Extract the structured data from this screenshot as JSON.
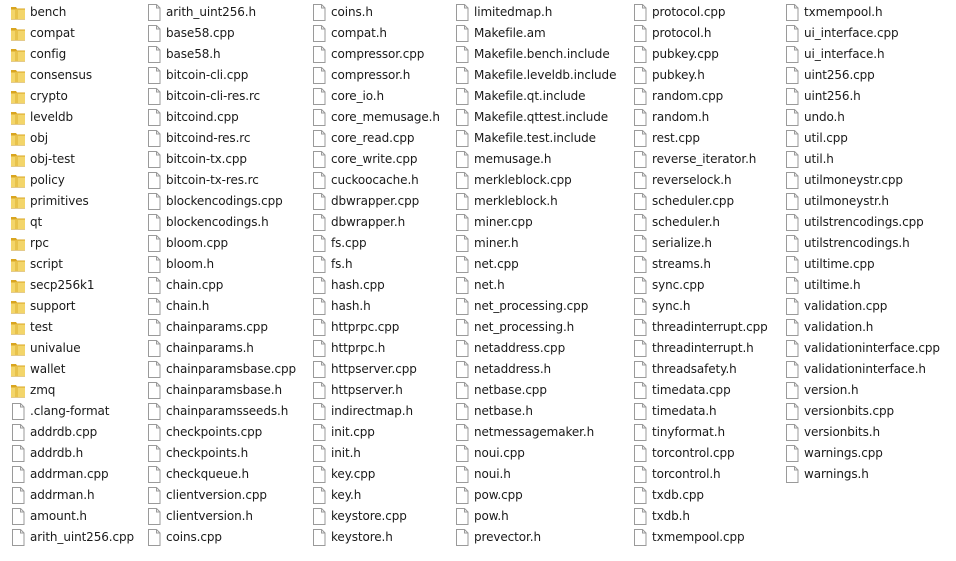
{
  "view": {
    "columns": [
      {
        "items": [
          {
            "name": "bench",
            "type": "folder"
          },
          {
            "name": "compat",
            "type": "folder"
          },
          {
            "name": "config",
            "type": "folder"
          },
          {
            "name": "consensus",
            "type": "folder"
          },
          {
            "name": "crypto",
            "type": "folder"
          },
          {
            "name": "leveldb",
            "type": "folder"
          },
          {
            "name": "obj",
            "type": "folder"
          },
          {
            "name": "obj-test",
            "type": "folder"
          },
          {
            "name": "policy",
            "type": "folder"
          },
          {
            "name": "primitives",
            "type": "folder"
          },
          {
            "name": "qt",
            "type": "folder"
          },
          {
            "name": "rpc",
            "type": "folder"
          },
          {
            "name": "script",
            "type": "folder"
          },
          {
            "name": "secp256k1",
            "type": "folder"
          },
          {
            "name": "support",
            "type": "folder"
          },
          {
            "name": "test",
            "type": "folder"
          },
          {
            "name": "univalue",
            "type": "folder"
          },
          {
            "name": "wallet",
            "type": "folder"
          },
          {
            "name": "zmq",
            "type": "folder"
          },
          {
            "name": ".clang-format",
            "type": "file"
          },
          {
            "name": "addrdb.cpp",
            "type": "file"
          },
          {
            "name": "addrdb.h",
            "type": "file"
          },
          {
            "name": "addrman.cpp",
            "type": "file"
          },
          {
            "name": "addrman.h",
            "type": "file"
          },
          {
            "name": "amount.h",
            "type": "file"
          },
          {
            "name": "arith_uint256.cpp",
            "type": "file"
          }
        ]
      },
      {
        "items": [
          {
            "name": "arith_uint256.h",
            "type": "file"
          },
          {
            "name": "base58.cpp",
            "type": "file"
          },
          {
            "name": "base58.h",
            "type": "file"
          },
          {
            "name": "bitcoin-cli.cpp",
            "type": "file"
          },
          {
            "name": "bitcoin-cli-res.rc",
            "type": "file"
          },
          {
            "name": "bitcoind.cpp",
            "type": "file"
          },
          {
            "name": "bitcoind-res.rc",
            "type": "file"
          },
          {
            "name": "bitcoin-tx.cpp",
            "type": "file"
          },
          {
            "name": "bitcoin-tx-res.rc",
            "type": "file"
          },
          {
            "name": "blockencodings.cpp",
            "type": "file"
          },
          {
            "name": "blockencodings.h",
            "type": "file"
          },
          {
            "name": "bloom.cpp",
            "type": "file"
          },
          {
            "name": "bloom.h",
            "type": "file"
          },
          {
            "name": "chain.cpp",
            "type": "file"
          },
          {
            "name": "chain.h",
            "type": "file"
          },
          {
            "name": "chainparams.cpp",
            "type": "file"
          },
          {
            "name": "chainparams.h",
            "type": "file"
          },
          {
            "name": "chainparamsbase.cpp",
            "type": "file"
          },
          {
            "name": "chainparamsbase.h",
            "type": "file"
          },
          {
            "name": "chainparamsseeds.h",
            "type": "file"
          },
          {
            "name": "checkpoints.cpp",
            "type": "file"
          },
          {
            "name": "checkpoints.h",
            "type": "file"
          },
          {
            "name": "checkqueue.h",
            "type": "file"
          },
          {
            "name": "clientversion.cpp",
            "type": "file"
          },
          {
            "name": "clientversion.h",
            "type": "file"
          },
          {
            "name": "coins.cpp",
            "type": "file"
          }
        ]
      },
      {
        "items": [
          {
            "name": "coins.h",
            "type": "file"
          },
          {
            "name": "compat.h",
            "type": "file"
          },
          {
            "name": "compressor.cpp",
            "type": "file"
          },
          {
            "name": "compressor.h",
            "type": "file"
          },
          {
            "name": "core_io.h",
            "type": "file"
          },
          {
            "name": "core_memusage.h",
            "type": "file"
          },
          {
            "name": "core_read.cpp",
            "type": "file"
          },
          {
            "name": "core_write.cpp",
            "type": "file"
          },
          {
            "name": "cuckoocache.h",
            "type": "file"
          },
          {
            "name": "dbwrapper.cpp",
            "type": "file"
          },
          {
            "name": "dbwrapper.h",
            "type": "file"
          },
          {
            "name": "fs.cpp",
            "type": "file"
          },
          {
            "name": "fs.h",
            "type": "file"
          },
          {
            "name": "hash.cpp",
            "type": "file"
          },
          {
            "name": "hash.h",
            "type": "file"
          },
          {
            "name": "httprpc.cpp",
            "type": "file"
          },
          {
            "name": "httprpc.h",
            "type": "file"
          },
          {
            "name": "httpserver.cpp",
            "type": "file"
          },
          {
            "name": "httpserver.h",
            "type": "file"
          },
          {
            "name": "indirectmap.h",
            "type": "file"
          },
          {
            "name": "init.cpp",
            "type": "file"
          },
          {
            "name": "init.h",
            "type": "file"
          },
          {
            "name": "key.cpp",
            "type": "file"
          },
          {
            "name": "key.h",
            "type": "file"
          },
          {
            "name": "keystore.cpp",
            "type": "file"
          },
          {
            "name": "keystore.h",
            "type": "file"
          }
        ]
      },
      {
        "items": [
          {
            "name": "limitedmap.h",
            "type": "file"
          },
          {
            "name": "Makefile.am",
            "type": "file"
          },
          {
            "name": "Makefile.bench.include",
            "type": "file"
          },
          {
            "name": "Makefile.leveldb.include",
            "type": "file"
          },
          {
            "name": "Makefile.qt.include",
            "type": "file"
          },
          {
            "name": "Makefile.qttest.include",
            "type": "file"
          },
          {
            "name": "Makefile.test.include",
            "type": "file"
          },
          {
            "name": "memusage.h",
            "type": "file"
          },
          {
            "name": "merkleblock.cpp",
            "type": "file"
          },
          {
            "name": "merkleblock.h",
            "type": "file"
          },
          {
            "name": "miner.cpp",
            "type": "file"
          },
          {
            "name": "miner.h",
            "type": "file"
          },
          {
            "name": "net.cpp",
            "type": "file"
          },
          {
            "name": "net.h",
            "type": "file"
          },
          {
            "name": "net_processing.cpp",
            "type": "file"
          },
          {
            "name": "net_processing.h",
            "type": "file"
          },
          {
            "name": "netaddress.cpp",
            "type": "file"
          },
          {
            "name": "netaddress.h",
            "type": "file"
          },
          {
            "name": "netbase.cpp",
            "type": "file"
          },
          {
            "name": "netbase.h",
            "type": "file"
          },
          {
            "name": "netmessagemaker.h",
            "type": "file"
          },
          {
            "name": "noui.cpp",
            "type": "file"
          },
          {
            "name": "noui.h",
            "type": "file"
          },
          {
            "name": "pow.cpp",
            "type": "file"
          },
          {
            "name": "pow.h",
            "type": "file"
          },
          {
            "name": "prevector.h",
            "type": "file"
          }
        ]
      },
      {
        "items": [
          {
            "name": "protocol.cpp",
            "type": "file"
          },
          {
            "name": "protocol.h",
            "type": "file"
          },
          {
            "name": "pubkey.cpp",
            "type": "file"
          },
          {
            "name": "pubkey.h",
            "type": "file"
          },
          {
            "name": "random.cpp",
            "type": "file"
          },
          {
            "name": "random.h",
            "type": "file"
          },
          {
            "name": "rest.cpp",
            "type": "file"
          },
          {
            "name": "reverse_iterator.h",
            "type": "file"
          },
          {
            "name": "reverselock.h",
            "type": "file"
          },
          {
            "name": "scheduler.cpp",
            "type": "file"
          },
          {
            "name": "scheduler.h",
            "type": "file"
          },
          {
            "name": "serialize.h",
            "type": "file"
          },
          {
            "name": "streams.h",
            "type": "file"
          },
          {
            "name": "sync.cpp",
            "type": "file"
          },
          {
            "name": "sync.h",
            "type": "file"
          },
          {
            "name": "threadinterrupt.cpp",
            "type": "file"
          },
          {
            "name": "threadinterrupt.h",
            "type": "file"
          },
          {
            "name": "threadsafety.h",
            "type": "file"
          },
          {
            "name": "timedata.cpp",
            "type": "file"
          },
          {
            "name": "timedata.h",
            "type": "file"
          },
          {
            "name": "tinyformat.h",
            "type": "file"
          },
          {
            "name": "torcontrol.cpp",
            "type": "file"
          },
          {
            "name": "torcontrol.h",
            "type": "file"
          },
          {
            "name": "txdb.cpp",
            "type": "file"
          },
          {
            "name": "txdb.h",
            "type": "file"
          },
          {
            "name": "txmempool.cpp",
            "type": "file"
          }
        ]
      },
      {
        "items": [
          {
            "name": "txmempool.h",
            "type": "file"
          },
          {
            "name": "ui_interface.cpp",
            "type": "file"
          },
          {
            "name": "ui_interface.h",
            "type": "file"
          },
          {
            "name": "uint256.cpp",
            "type": "file"
          },
          {
            "name": "uint256.h",
            "type": "file"
          },
          {
            "name": "undo.h",
            "type": "file"
          },
          {
            "name": "util.cpp",
            "type": "file"
          },
          {
            "name": "util.h",
            "type": "file"
          },
          {
            "name": "utilmoneystr.cpp",
            "type": "file"
          },
          {
            "name": "utilmoneystr.h",
            "type": "file"
          },
          {
            "name": "utilstrencodings.cpp",
            "type": "file"
          },
          {
            "name": "utilstrencodings.h",
            "type": "file"
          },
          {
            "name": "utiltime.cpp",
            "type": "file"
          },
          {
            "name": "utiltime.h",
            "type": "file"
          },
          {
            "name": "validation.cpp",
            "type": "file"
          },
          {
            "name": "validation.h",
            "type": "file"
          },
          {
            "name": "validationinterface.cpp",
            "type": "file"
          },
          {
            "name": "validationinterface.h",
            "type": "file"
          },
          {
            "name": "version.h",
            "type": "file"
          },
          {
            "name": "versionbits.cpp",
            "type": "file"
          },
          {
            "name": "versionbits.h",
            "type": "file"
          },
          {
            "name": "warnings.cpp",
            "type": "file"
          },
          {
            "name": "warnings.h",
            "type": "file"
          }
        ]
      }
    ]
  },
  "colors": {
    "folder_back": "#d9a520",
    "folder_front": "#f3d56a",
    "file_border": "#9a9a9a",
    "file_fill": "#ffffff",
    "text": "#1a1a1a"
  }
}
